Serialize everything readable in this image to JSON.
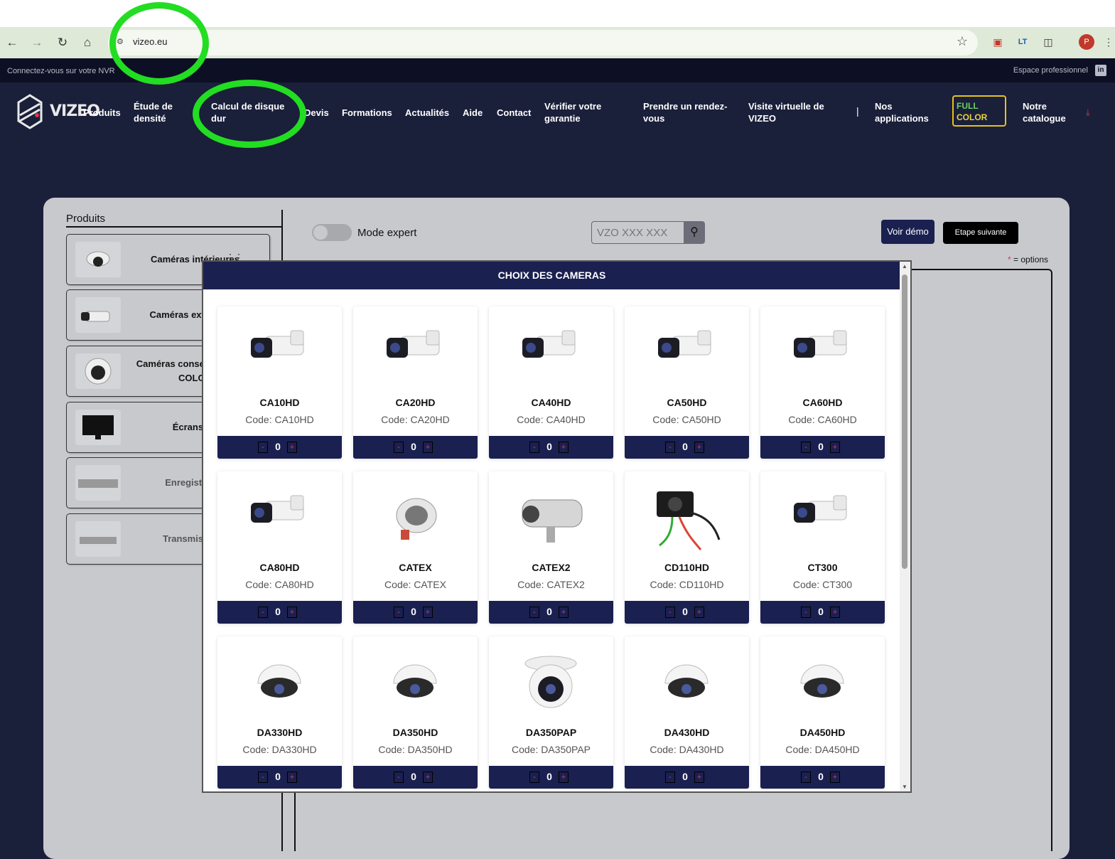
{
  "browser": {
    "url": "vizeo.eu",
    "profile_initial": "P"
  },
  "site": {
    "topbar_left": "Connectez-vous sur votre NVR",
    "topbar_right": "Espace professionnel",
    "linkedin_label": "in",
    "logo_text": "VIZEO",
    "nav": [
      {
        "label": "Produits"
      },
      {
        "label": "Étude de densité"
      },
      {
        "label": "Calcul de disque dur"
      },
      {
        "label": "Devis"
      },
      {
        "label": "Formations"
      },
      {
        "label": "Actualités"
      },
      {
        "label": "Aide"
      },
      {
        "label": "Contact"
      },
      {
        "label": "Vérifier votre garantie"
      },
      {
        "label": "Prendre un rendez-vous"
      },
      {
        "label": "Visite virtuelle de VIZEO"
      },
      {
        "label": "Nos applications"
      },
      {
        "label": "Notre catalogue"
      }
    ],
    "nav_separator": "|",
    "fullcolor_line1": "FULL",
    "fullcolor_line2": "COLOR"
  },
  "panel": {
    "sidebar_title": "Produits",
    "categories": [
      {
        "label": "Caméras intérieures"
      },
      {
        "label": "Caméras extérieures"
      },
      {
        "label": "Caméras conseillées FULL COLOR"
      },
      {
        "label": "Écrans TV"
      },
      {
        "label": "Enregistreurs"
      },
      {
        "label": "Transmissions"
      }
    ],
    "mode_expert_label": "Mode expert",
    "search_placeholder": "VZO XXX XXX",
    "demo_button": "Voir démo",
    "next_button": "Etape suivante",
    "options_asterisk": "*",
    "options_note": " = options"
  },
  "modal": {
    "title": "CHOIX DES CAMERAS",
    "cameras": [
      {
        "name": "CA10HD",
        "code": "Code: CA10HD",
        "qty": "0",
        "icon": "bullet-camera-icon"
      },
      {
        "name": "CA20HD",
        "code": "Code: CA20HD",
        "qty": "0",
        "icon": "bullet-camera-icon"
      },
      {
        "name": "CA40HD",
        "code": "Code: CA40HD",
        "qty": "0",
        "icon": "bullet-camera-icon"
      },
      {
        "name": "CA50HD",
        "code": "Code: CA50HD",
        "qty": "0",
        "icon": "bullet-camera-icon"
      },
      {
        "name": "CA60HD",
        "code": "Code: CA60HD",
        "qty": "0",
        "icon": "bullet-camera-icon"
      },
      {
        "name": "CA80HD",
        "code": "Code: CA80HD",
        "qty": "0",
        "icon": "bullet-camera-icon"
      },
      {
        "name": "CATEX",
        "code": "Code: CATEX",
        "qty": "0",
        "icon": "explosion-proof-camera-icon"
      },
      {
        "name": "CATEX2",
        "code": "Code: CATEX2",
        "qty": "0",
        "icon": "housing-camera-icon"
      },
      {
        "name": "CD110HD",
        "code": "Code: CD110HD",
        "qty": "0",
        "icon": "mini-camera-icon"
      },
      {
        "name": "CT300",
        "code": "Code: CT300",
        "qty": "0",
        "icon": "bullet-camera-icon"
      },
      {
        "name": "DA330HD",
        "code": "Code: DA330HD",
        "qty": "0",
        "icon": "dome-camera-icon"
      },
      {
        "name": "DA350HD",
        "code": "Code: DA350HD",
        "qty": "0",
        "icon": "dome-camera-icon"
      },
      {
        "name": "DA350PAP",
        "code": "Code: DA350PAP",
        "qty": "0",
        "icon": "turret-camera-icon"
      },
      {
        "name": "DA430HD",
        "code": "Code: DA430HD",
        "qty": "0",
        "icon": "dome-camera-icon"
      },
      {
        "name": "DA450HD",
        "code": "Code: DA450HD",
        "qty": "0",
        "icon": "dome-camera-icon"
      }
    ],
    "minus_label": "-",
    "plus_label": "+"
  },
  "colors": {
    "navy": "#1a2050",
    "accent_red": "#e0344a",
    "highlight_green": "#22dd22"
  }
}
